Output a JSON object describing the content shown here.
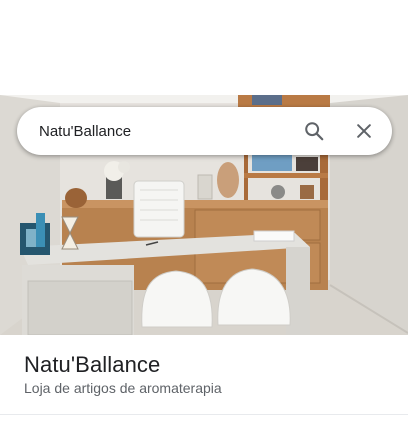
{
  "search": {
    "value": "Natu'Ballance",
    "search_icon": "search-icon",
    "close_icon": "close-icon"
  },
  "place": {
    "name": "Natu'Ballance",
    "category": "Loja de artigos de aromaterapia"
  },
  "colors": {
    "title_text": "#202124",
    "secondary_text": "#5f6368",
    "icon": "#5f6368"
  }
}
